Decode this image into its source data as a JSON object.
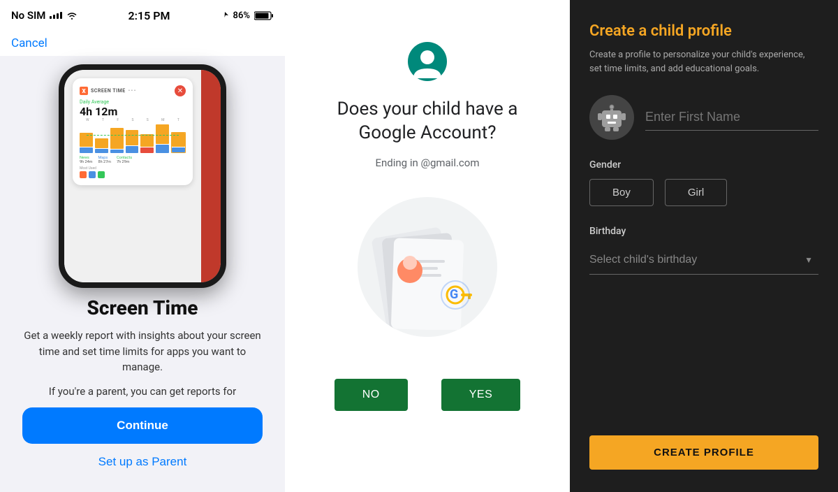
{
  "panel1": {
    "statusBar": {
      "carrier": "No SIM",
      "time": "2:15 PM",
      "battery": "86%"
    },
    "cancelLabel": "Cancel",
    "phoneCard": {
      "appLabel": "SCREEN TIME",
      "dailyAvgLabel": "Daily Average",
      "timeValue": "4h 12m",
      "days": [
        "W",
        "T",
        "F",
        "S",
        "S",
        "M",
        "T"
      ],
      "newsLabel": "News",
      "newsTime": "9h 24m",
      "mapsLabel": "Maps",
      "mapsTime": "8h 27m",
      "contactsLabel": "Contacts",
      "contactsTime": "7h 29m",
      "mostUsedLabel": "Most Used"
    },
    "title": "Screen Time",
    "description": "Get a weekly report with insights about your screen time and set time limits for apps you want to manage.",
    "parentText": "If you're a parent, you can get reports for",
    "continueLabel": "Continue",
    "setupLabel": "Set up as Parent"
  },
  "panel2": {
    "question": "Does your child have a Google Account?",
    "emailHint": "Ending in @gmail.com",
    "noLabel": "NO",
    "yesLabel": "YES"
  },
  "panel3": {
    "title": "Create a child profile",
    "description": "Create a profile to personalize your child's experience, set time limits, and add educational goals.",
    "namePlaceholder": "Enter First Name",
    "genderLabel": "Gender",
    "boyLabel": "Boy",
    "girlLabel": "Girl",
    "birthdayLabel": "Birthday",
    "birthdayPlaceholder": "Select child's birthday",
    "createProfileLabel": "CREATE PROFILE"
  }
}
